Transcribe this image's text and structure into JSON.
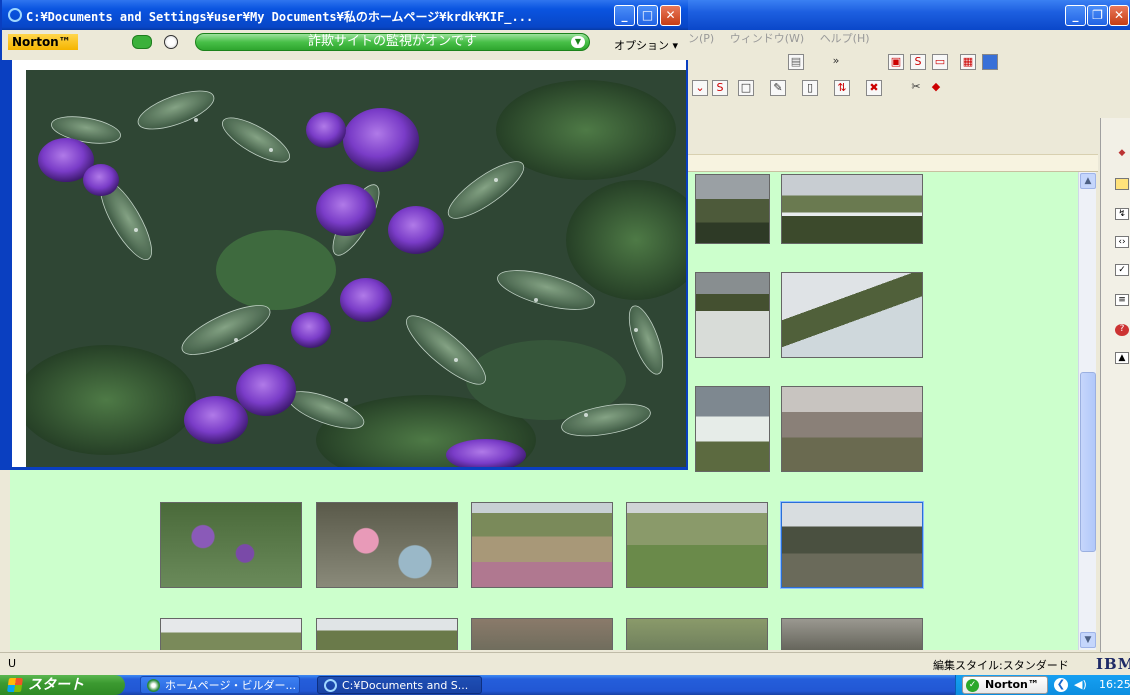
{
  "foreground_window": {
    "title": "C:¥Documents and Settings¥user¥My Documents¥私のホームページ¥krdk¥KIF_...",
    "norton_toolbar": {
      "brand": "Norton™",
      "status_text": "詐欺サイトの監視がオンです",
      "options_label": "オプション ▾"
    }
  },
  "background_window": {
    "menu": [
      "ン(P)",
      "ウィンドウ(W)",
      "ヘルプ(H)"
    ],
    "status_left": "U",
    "status_right": "編集スタイル:スタンダード",
    "brand_logo": "IBM"
  },
  "taskbar": {
    "start_label": "スタート",
    "items": [
      {
        "label": "ホームページ・ビルダー..."
      },
      {
        "label": "C:¥Documents and S..."
      }
    ],
    "tray_norton": "Norton™",
    "clock": "16:25"
  },
  "colors": {
    "page_background": "#ccffcc",
    "xp_blue": "#0a47c9",
    "norton_yellow": "#f5b400",
    "norton_green": "#48c048"
  }
}
